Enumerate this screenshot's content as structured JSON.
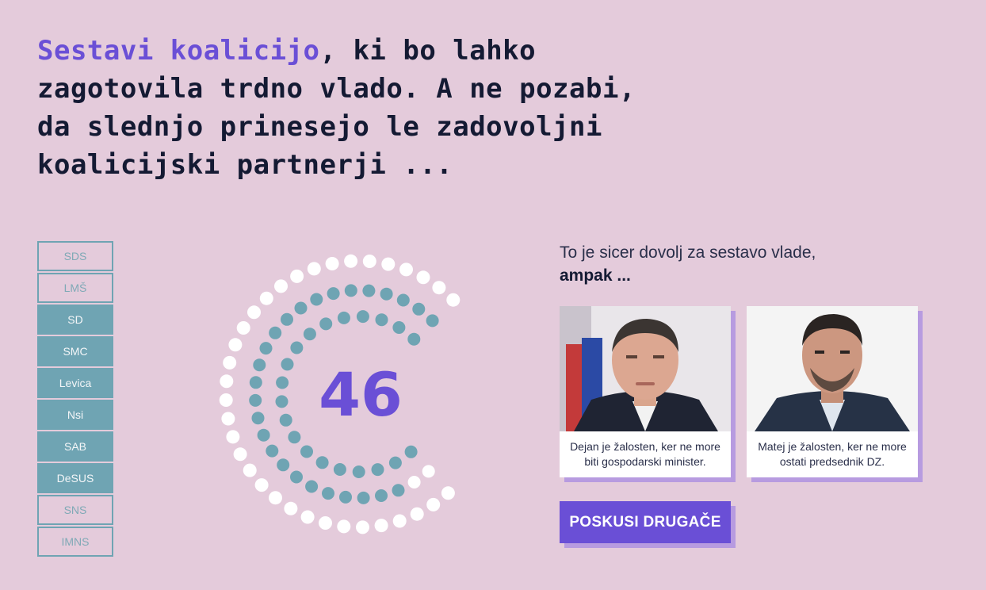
{
  "headline": {
    "accent": "Sestavi koalicijo",
    "lines": [
      ", ki bo lahko",
      "zagotovila trdno vlado. A ne pozabi,",
      "da slednjo prinesejo le zadovoljni",
      "koalicijski partnerji ..."
    ]
  },
  "parties": [
    {
      "label": "SDS",
      "selected": false
    },
    {
      "label": "LMŠ",
      "selected": false
    },
    {
      "label": "SD",
      "selected": true
    },
    {
      "label": "SMC",
      "selected": true
    },
    {
      "label": "Levica",
      "selected": true
    },
    {
      "label": "Nsi",
      "selected": true
    },
    {
      "label": "SAB",
      "selected": true
    },
    {
      "label": "DeSUS",
      "selected": true
    },
    {
      "label": "SNS",
      "selected": false
    },
    {
      "label": "IMNS",
      "selected": false
    }
  ],
  "parliament": {
    "seats_total": 90,
    "seats_selected": 46,
    "seat_count_label": "46",
    "colors": {
      "selected": "#6fa4b3",
      "unselected": "#ffffff",
      "accent": "#6a4fd6"
    }
  },
  "intro": {
    "text": "To je sicer dovolj za sestavo vlade,",
    "strong": "ampak ..."
  },
  "cards": [
    {
      "caption": "Dejan je žalosten, ker ne more biti gospodarski minister.",
      "photo_icon": "person-photo"
    },
    {
      "caption": "Matej je žalosten, ker ne more ostati predsednik DZ.",
      "photo_icon": "person-photo"
    }
  ],
  "retry_button": "POSKUSI DRUGAČE"
}
